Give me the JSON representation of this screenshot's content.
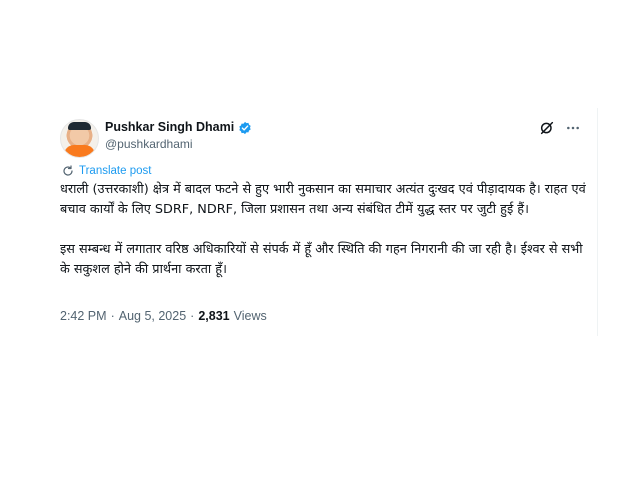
{
  "author": {
    "display_name": "Pushkar Singh Dhami",
    "handle": "@pushkardhami",
    "verified": true,
    "verified_color": "#1d9bf0"
  },
  "actions": {
    "translate_label": "Translate post",
    "grok_icon": "grok-icon",
    "more_icon": "more-icon"
  },
  "post": {
    "paragraph_1": "धराली (उत्तरकाशी) क्षेत्र में बादल फटने से हुए भारी नुकसान का समाचार अत्यंत दुःखद एवं पीड़ादायक है। राहत एवं बचाव कार्यों के लिए SDRF, NDRF, जिला प्रशासन तथा अन्य संबंधित टीमें युद्ध स्तर पर जुटी हुई हैं।",
    "paragraph_2": "इस सम्बन्ध में लगातार वरिष्ठ अधिकारियों से संपर्क में हूँ और स्थिति की गहन निगरानी की जा रही है। ईश्वर से सभी के सकुशल होने की प्रार्थना करता हूँ।"
  },
  "meta": {
    "time": "2:42 PM",
    "separator": "·",
    "date": "Aug 5, 2025",
    "views_count": "2,831",
    "views_label": "Views"
  },
  "colors": {
    "text": "#0f1419",
    "secondary": "#536471",
    "accent": "#1d9bf0"
  }
}
